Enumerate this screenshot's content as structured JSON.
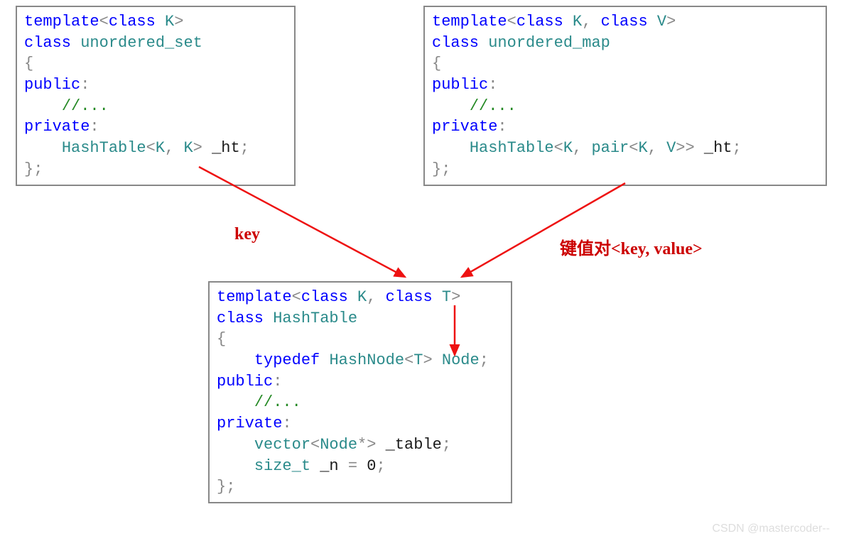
{
  "box_set": {
    "line1": {
      "kw1": "template",
      "op1": "<",
      "kw2": "class",
      "sp1": " ",
      "id1": "K",
      "op2": ">"
    },
    "line2": {
      "kw1": "class",
      "sp1": " ",
      "id1": "unordered_set"
    },
    "line3": "{",
    "line4": {
      "kw1": "public",
      "op1": ":"
    },
    "line5": {
      "indent": "    ",
      "cm": "//..."
    },
    "line6": {
      "kw1": "private",
      "op1": ":"
    },
    "line7": {
      "indent": "    ",
      "id1": "HashTable",
      "op1": "<",
      "id2": "K",
      "op2": ", ",
      "id3": "K",
      "op3": "> ",
      "dark1": "_ht",
      "op4": ";"
    },
    "line8": "};"
  },
  "box_map": {
    "line1": {
      "kw1": "template",
      "op1": "<",
      "kw2": "class",
      "sp1": " ",
      "id1": "K",
      "op2": ", ",
      "kw3": "class",
      "sp2": " ",
      "id2": "V",
      "op3": ">"
    },
    "line2": {
      "kw1": "class",
      "sp1": " ",
      "id1": "unordered_map"
    },
    "line3": "{",
    "line4": {
      "kw1": "public",
      "op1": ":"
    },
    "line5": {
      "indent": "    ",
      "cm": "//..."
    },
    "line6": {
      "kw1": "private",
      "op1": ":"
    },
    "line7": {
      "indent": "    ",
      "id1": "HashTable",
      "op1": "<",
      "id2": "K",
      "op2": ", ",
      "id3": "pair",
      "op3": "<",
      "id4": "K",
      "op4": ", ",
      "id5": "V",
      "op5": ">> ",
      "dark1": "_ht",
      "op6": ";"
    },
    "line8": "};"
  },
  "box_hash": {
    "line1": {
      "kw1": "template",
      "op1": "<",
      "kw2": "class",
      "sp1": " ",
      "id1": "K",
      "op2": ", ",
      "kw3": "class",
      "sp2": " ",
      "id2": "T",
      "op3": ">"
    },
    "line2": {
      "kw1": "class",
      "sp1": " ",
      "id1": "HashTable"
    },
    "line3": "{",
    "line4": {
      "indent": "    ",
      "kw1": "typedef",
      "sp1": " ",
      "id1": "HashNode",
      "op1": "<",
      "id2": "T",
      "op2": "> ",
      "id3": "Node",
      "op3": ";"
    },
    "line5": {
      "kw1": "public",
      "op1": ":"
    },
    "line6": {
      "indent": "    ",
      "cm": "//..."
    },
    "line7": {
      "kw1": "private",
      "op1": ":"
    },
    "line8": {
      "indent": "    ",
      "id1": "vector",
      "op1": "<",
      "id2": "Node",
      "op2": "*> ",
      "dark1": "_table",
      "op3": ";"
    },
    "line9": {
      "indent": "    ",
      "id1": "size_t",
      "sp1": " ",
      "dark1": "_n ",
      "gray1": "= ",
      "dark2": "0",
      "gray2": ";"
    },
    "line10": "};"
  },
  "labels": {
    "left": "key",
    "right": "键值对<key, value>"
  },
  "watermark": "CSDN @mastercoder--"
}
